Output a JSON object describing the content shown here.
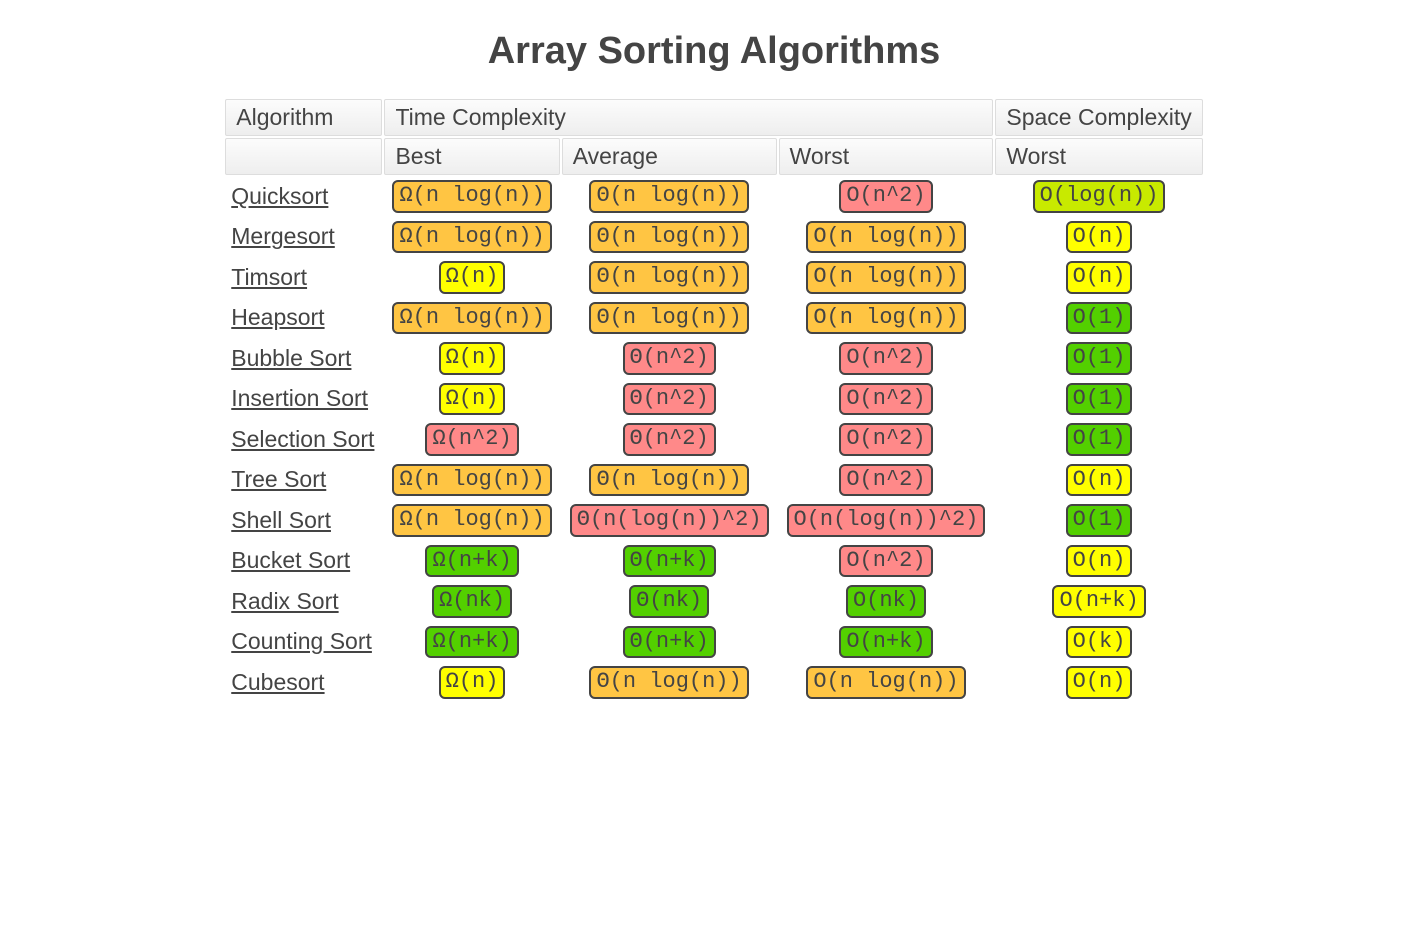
{
  "title": "Array Sorting Algorithms",
  "headers": {
    "algorithm": "Algorithm",
    "time": "Time Complexity",
    "space": "Space Complexity",
    "best": "Best",
    "average": "Average",
    "worst": "Worst",
    "space_worst": "Worst"
  },
  "rows": [
    {
      "name": "Quicksort",
      "best": {
        "txt": "Ω(n log(n))",
        "cls": "orange"
      },
      "avg": {
        "txt": "Θ(n log(n))",
        "cls": "orange"
      },
      "worst": {
        "txt": "O(n^2)",
        "cls": "red"
      },
      "space": {
        "txt": "O(log(n))",
        "cls": "yellowgreen"
      }
    },
    {
      "name": "Mergesort",
      "best": {
        "txt": "Ω(n log(n))",
        "cls": "orange"
      },
      "avg": {
        "txt": "Θ(n log(n))",
        "cls": "orange"
      },
      "worst": {
        "txt": "O(n log(n))",
        "cls": "orange"
      },
      "space": {
        "txt": "O(n)",
        "cls": "yellow"
      }
    },
    {
      "name": "Timsort",
      "best": {
        "txt": "Ω(n)",
        "cls": "yellow"
      },
      "avg": {
        "txt": "Θ(n log(n))",
        "cls": "orange"
      },
      "worst": {
        "txt": "O(n log(n))",
        "cls": "orange"
      },
      "space": {
        "txt": "O(n)",
        "cls": "yellow"
      }
    },
    {
      "name": "Heapsort",
      "best": {
        "txt": "Ω(n log(n))",
        "cls": "orange"
      },
      "avg": {
        "txt": "Θ(n log(n))",
        "cls": "orange"
      },
      "worst": {
        "txt": "O(n log(n))",
        "cls": "orange"
      },
      "space": {
        "txt": "O(1)",
        "cls": "green"
      }
    },
    {
      "name": "Bubble Sort",
      "best": {
        "txt": "Ω(n)",
        "cls": "yellow"
      },
      "avg": {
        "txt": "Θ(n^2)",
        "cls": "red"
      },
      "worst": {
        "txt": "O(n^2)",
        "cls": "red"
      },
      "space": {
        "txt": "O(1)",
        "cls": "green"
      }
    },
    {
      "name": "Insertion Sort",
      "best": {
        "txt": "Ω(n)",
        "cls": "yellow"
      },
      "avg": {
        "txt": "Θ(n^2)",
        "cls": "red"
      },
      "worst": {
        "txt": "O(n^2)",
        "cls": "red"
      },
      "space": {
        "txt": "O(1)",
        "cls": "green"
      }
    },
    {
      "name": "Selection Sort",
      "best": {
        "txt": "Ω(n^2)",
        "cls": "red"
      },
      "avg": {
        "txt": "Θ(n^2)",
        "cls": "red"
      },
      "worst": {
        "txt": "O(n^2)",
        "cls": "red"
      },
      "space": {
        "txt": "O(1)",
        "cls": "green"
      }
    },
    {
      "name": "Tree Sort",
      "best": {
        "txt": "Ω(n log(n))",
        "cls": "orange"
      },
      "avg": {
        "txt": "Θ(n log(n))",
        "cls": "orange"
      },
      "worst": {
        "txt": "O(n^2)",
        "cls": "red"
      },
      "space": {
        "txt": "O(n)",
        "cls": "yellow"
      }
    },
    {
      "name": "Shell Sort",
      "best": {
        "txt": "Ω(n log(n))",
        "cls": "orange"
      },
      "avg": {
        "txt": "Θ(n(log(n))^2)",
        "cls": "red"
      },
      "worst": {
        "txt": "O(n(log(n))^2)",
        "cls": "red"
      },
      "space": {
        "txt": "O(1)",
        "cls": "green"
      }
    },
    {
      "name": "Bucket Sort",
      "best": {
        "txt": "Ω(n+k)",
        "cls": "green"
      },
      "avg": {
        "txt": "Θ(n+k)",
        "cls": "green"
      },
      "worst": {
        "txt": "O(n^2)",
        "cls": "red"
      },
      "space": {
        "txt": "O(n)",
        "cls": "yellow"
      }
    },
    {
      "name": "Radix Sort",
      "best": {
        "txt": "Ω(nk)",
        "cls": "green"
      },
      "avg": {
        "txt": "Θ(nk)",
        "cls": "green"
      },
      "worst": {
        "txt": "O(nk)",
        "cls": "green"
      },
      "space": {
        "txt": "O(n+k)",
        "cls": "yellow"
      }
    },
    {
      "name": "Counting Sort",
      "best": {
        "txt": "Ω(n+k)",
        "cls": "green"
      },
      "avg": {
        "txt": "Θ(n+k)",
        "cls": "green"
      },
      "worst": {
        "txt": "O(n+k)",
        "cls": "green"
      },
      "space": {
        "txt": "O(k)",
        "cls": "yellow"
      }
    },
    {
      "name": "Cubesort",
      "best": {
        "txt": "Ω(n)",
        "cls": "yellow"
      },
      "avg": {
        "txt": "Θ(n log(n))",
        "cls": "orange"
      },
      "worst": {
        "txt": "O(n log(n))",
        "cls": "orange"
      },
      "space": {
        "txt": "O(n)",
        "cls": "yellow"
      }
    }
  ]
}
